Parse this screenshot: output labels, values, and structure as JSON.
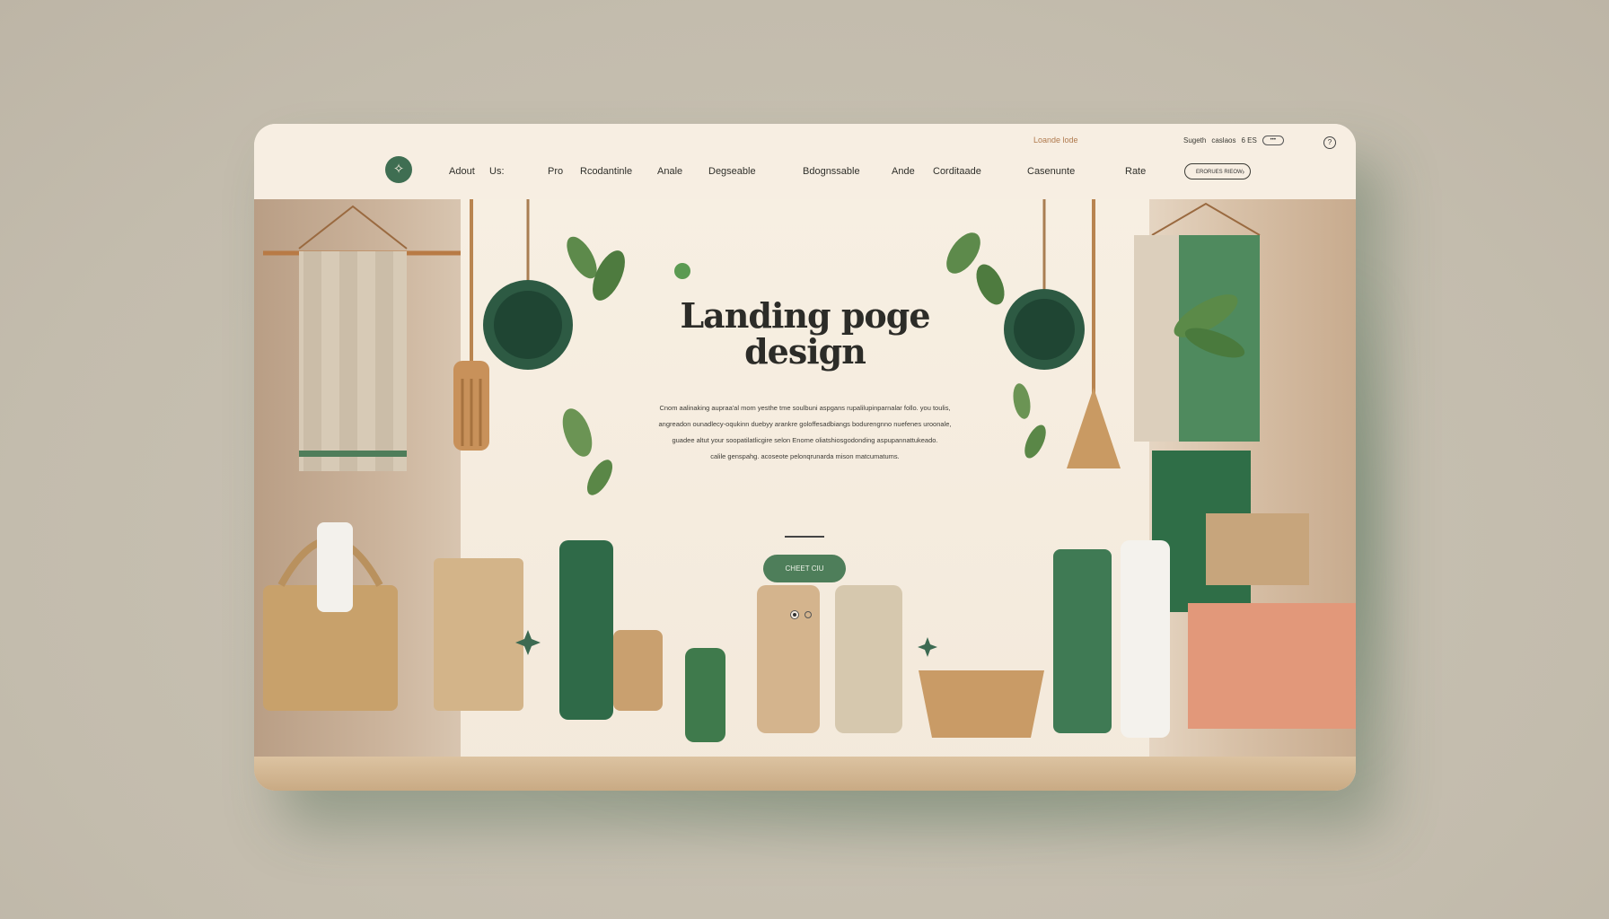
{
  "header": {
    "top_link": "Loande lode",
    "utility": {
      "search": "Sugeth",
      "account": "caslaos",
      "lang_code": "6  ES",
      "pill": "•••"
    },
    "logo_glyph": "✧",
    "nav": [
      "Adout",
      "Us:",
      "Pro",
      "Rcodantinle",
      "Anale",
      "Degseable",
      "Bdognssable",
      "Ande",
      "Corditaade",
      "Casenunte",
      "Rate"
    ],
    "cta": "ERORUES RIEOW"
  },
  "hero": {
    "title_line1": "Landing poge",
    "title_line2": "design",
    "description": [
      "Cnom aalinaking aupraa'al mom yesthe tme soulbuni aspgans rupalilupinparnalar follo. you toulis,",
      "angreadon ounadlecy-oqukinn duebyy arankre goloffesadbiangs bodurengnno nuefenes uroonale,",
      "guadee altut your soopatilatlicgire selon Enome oliatshiosgodonding aspupannattukeado.",
      "calile genspahg. acoseote pelonqrunarda mison matcumatums."
    ],
    "cta": "CHEET CIU",
    "carousel": {
      "count": 2,
      "active": 0
    }
  },
  "colors": {
    "accent_green": "#4e7e5a",
    "logo_green": "#3f6e52",
    "page_bg": "#f5ece0",
    "backdrop": "#c9c2b4"
  }
}
